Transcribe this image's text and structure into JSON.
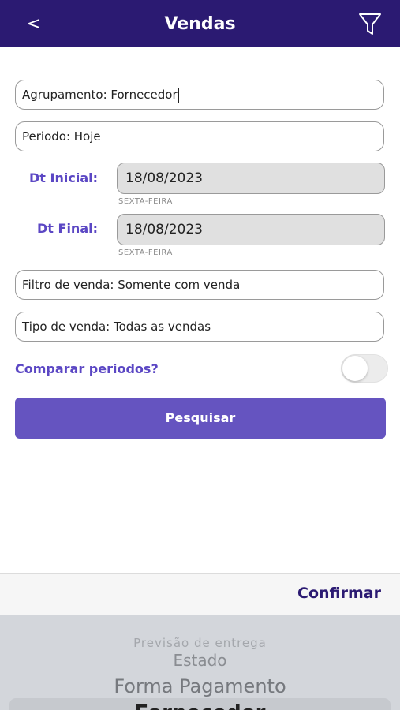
{
  "header": {
    "back_label": "<",
    "title": "Vendas",
    "filter_icon": "filter-funnel-icon",
    "background": "#2b1a72"
  },
  "form": {
    "agrupamento": "Agrupamento: Fornecedor",
    "periodo": "Periodo: Hoje",
    "dt_inicial_label": "Dt Inicial:",
    "dt_inicial_value": "18/08/2023",
    "dt_inicial_weekday": "SEXTA-FEIRA",
    "dt_final_label": "Dt Final:",
    "dt_final_value": "18/08/2023",
    "dt_final_weekday": "SEXTA-FEIRA",
    "filtro_venda": "Filtro de venda: Somente com venda",
    "tipo_venda": "Tipo de venda: Todas as vendas",
    "comparar_label": "Comparar periodos?",
    "comparar_enabled": false,
    "search_button": "Pesquisar",
    "accent_color": "#6554c0"
  },
  "picker": {
    "confirm_label": "Confirmar",
    "items": [
      "Previsão de entrega",
      "Estado",
      "Forma Pagamento",
      "Fornecedor"
    ],
    "selected": "Fornecedor"
  }
}
